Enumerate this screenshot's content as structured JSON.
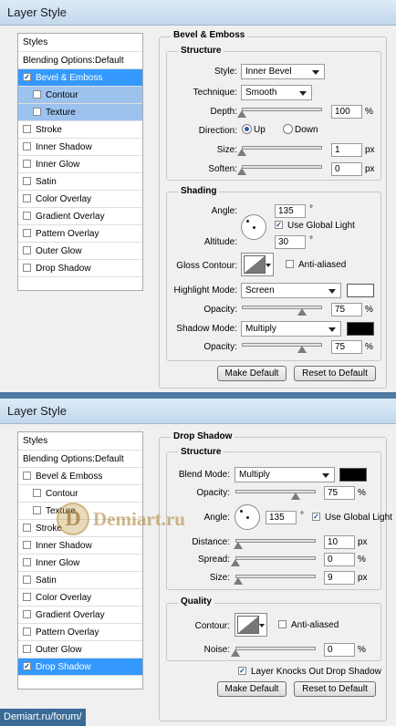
{
  "dialog1": {
    "title": "Layer Style",
    "left_panel": [
      {
        "label": "Styles",
        "checkbox": false,
        "checked": false
      },
      {
        "label": "Blending Options:Default",
        "checkbox": false,
        "checked": false
      },
      {
        "label": "Bevel & Emboss",
        "checkbox": true,
        "checked": true,
        "state": "active"
      },
      {
        "label": "Contour",
        "checkbox": true,
        "checked": false,
        "sub": true,
        "state": "highlight"
      },
      {
        "label": "Texture",
        "checkbox": true,
        "checked": false,
        "sub": true,
        "state": "highlight"
      },
      {
        "label": "Stroke",
        "checkbox": true,
        "checked": false
      },
      {
        "label": "Inner Shadow",
        "checkbox": true,
        "checked": false
      },
      {
        "label": "Inner Glow",
        "checkbox": true,
        "checked": false
      },
      {
        "label": "Satin",
        "checkbox": true,
        "checked": false
      },
      {
        "label": "Color Overlay",
        "checkbox": true,
        "checked": false
      },
      {
        "label": "Gradient Overlay",
        "checkbox": true,
        "checked": false
      },
      {
        "label": "Pattern Overlay",
        "checkbox": true,
        "checked": false
      },
      {
        "label": "Outer Glow",
        "checkbox": true,
        "checked": false
      },
      {
        "label": "Drop Shadow",
        "checkbox": true,
        "checked": false
      }
    ],
    "section_title": "Bevel & Emboss",
    "structure": {
      "title": "Structure",
      "style_label": "Style:",
      "style_value": "Inner Bevel",
      "technique_label": "Technique:",
      "technique_value": "Smooth",
      "depth_label": "Depth:",
      "depth_value": "100",
      "depth_unit": "%",
      "depth_slider": 0.0,
      "direction_label": "Direction:",
      "direction_up": "Up",
      "direction_down": "Down",
      "direction_selected": "Up",
      "size_label": "Size:",
      "size_value": "1",
      "size_unit": "px",
      "size_slider": 0.0,
      "soften_label": "Soften:",
      "soften_value": "0",
      "soften_unit": "px",
      "soften_slider": 0.0
    },
    "shading": {
      "title": "Shading",
      "angle_label": "Angle:",
      "angle_value": "135",
      "angle_unit": "°",
      "global_light_label": "Use Global Light",
      "global_light_checked": true,
      "altitude_label": "Altitude:",
      "altitude_value": "30",
      "altitude_unit": "°",
      "gloss_label": "Gloss Contour:",
      "anti_aliased_label": "Anti-aliased",
      "anti_aliased_checked": false,
      "highlight_mode_label": "Highlight Mode:",
      "highlight_mode_value": "Screen",
      "highlight_color": "#ffffff",
      "highlight_opacity_label": "Opacity:",
      "highlight_opacity_value": "75",
      "highlight_opacity_unit": "%",
      "highlight_opacity_slider": 0.75,
      "shadow_mode_label": "Shadow Mode:",
      "shadow_mode_value": "Multiply",
      "shadow_color": "#000000",
      "shadow_opacity_label": "Opacity:",
      "shadow_opacity_value": "75",
      "shadow_opacity_unit": "%",
      "shadow_opacity_slider": 0.75
    },
    "make_default": "Make Default",
    "reset_default": "Reset to Default"
  },
  "dialog2": {
    "title": "Layer Style",
    "left_panel": [
      {
        "label": "Styles",
        "checkbox": false,
        "checked": false
      },
      {
        "label": "Blending Options:Default",
        "checkbox": false,
        "checked": false
      },
      {
        "label": "Bevel & Emboss",
        "checkbox": true,
        "checked": false
      },
      {
        "label": "Contour",
        "checkbox": true,
        "checked": false,
        "sub": true
      },
      {
        "label": "Texture",
        "checkbox": true,
        "checked": false,
        "sub": true
      },
      {
        "label": "Stroke",
        "checkbox": true,
        "checked": false
      },
      {
        "label": "Inner Shadow",
        "checkbox": true,
        "checked": false
      },
      {
        "label": "Inner Glow",
        "checkbox": true,
        "checked": false
      },
      {
        "label": "Satin",
        "checkbox": true,
        "checked": false
      },
      {
        "label": "Color Overlay",
        "checkbox": true,
        "checked": false
      },
      {
        "label": "Gradient Overlay",
        "checkbox": true,
        "checked": false
      },
      {
        "label": "Pattern Overlay",
        "checkbox": true,
        "checked": false
      },
      {
        "label": "Outer Glow",
        "checkbox": true,
        "checked": false
      },
      {
        "label": "Drop Shadow",
        "checkbox": true,
        "checked": true,
        "state": "active"
      }
    ],
    "section_title": "Drop Shadow",
    "structure": {
      "title": "Structure",
      "blend_mode_label": "Blend Mode:",
      "blend_mode_value": "Multiply",
      "blend_color": "#000000",
      "opacity_label": "Opacity:",
      "opacity_value": "75",
      "opacity_unit": "%",
      "opacity_slider": 0.75,
      "angle_label": "Angle:",
      "angle_value": "135",
      "angle_unit": "°",
      "global_light_label": "Use Global Light",
      "global_light_checked": true,
      "distance_label": "Distance:",
      "distance_value": "10",
      "distance_unit": "px",
      "distance_slider": 0.03,
      "spread_label": "Spread:",
      "spread_value": "0",
      "spread_unit": "%",
      "spread_slider": 0.0,
      "size_label": "Size:",
      "size_value": "9",
      "size_unit": "px",
      "size_slider": 0.03
    },
    "quality": {
      "title": "Quality",
      "contour_label": "Contour:",
      "anti_aliased_label": "Anti-aliased",
      "anti_aliased_checked": false,
      "noise_label": "Noise:",
      "noise_value": "0",
      "noise_unit": "%",
      "noise_slider": 0.0
    },
    "knocks_out_label": "Layer Knocks Out Drop Shadow",
    "knocks_out_checked": true,
    "make_default": "Make Default",
    "reset_default": "Reset to Default"
  },
  "watermark": {
    "logo_letter": "D",
    "text": "Demiart.ru"
  },
  "footer": "Demiart.ru/forum/"
}
